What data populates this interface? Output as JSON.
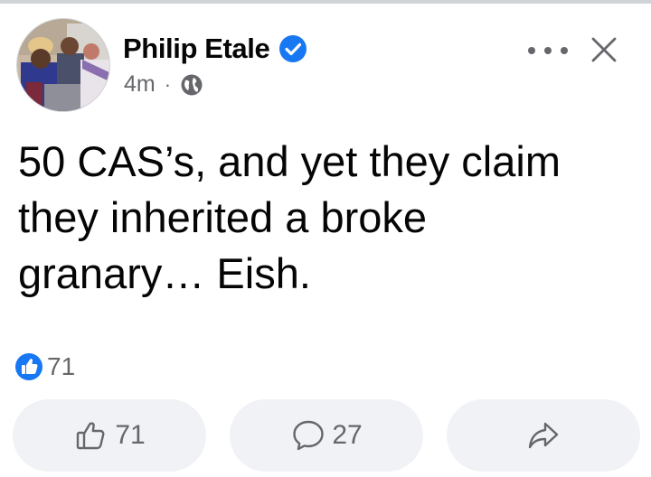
{
  "post": {
    "author": "Philip Etale",
    "time": "4m",
    "separator": "·",
    "text": "50 CAS’s, and yet they claim\nthey inherited a broke\ngranary… Eish.",
    "reaction_count": "71"
  },
  "actions": {
    "like_count": "71",
    "comment_count": "27"
  },
  "icons": {
    "verified": "verified-badge-icon",
    "privacy": "globe-icon",
    "more": "more-horizontal-icon",
    "close": "close-icon",
    "like_reaction": "like-reaction-icon",
    "like": "thumbs-up-icon",
    "comment": "comment-bubble-icon",
    "share": "share-arrow-icon"
  },
  "colors": {
    "brand_blue": "#1877f2",
    "text_primary": "#050505",
    "text_secondary": "#65676b",
    "button_bg": "#f0f2f5"
  }
}
